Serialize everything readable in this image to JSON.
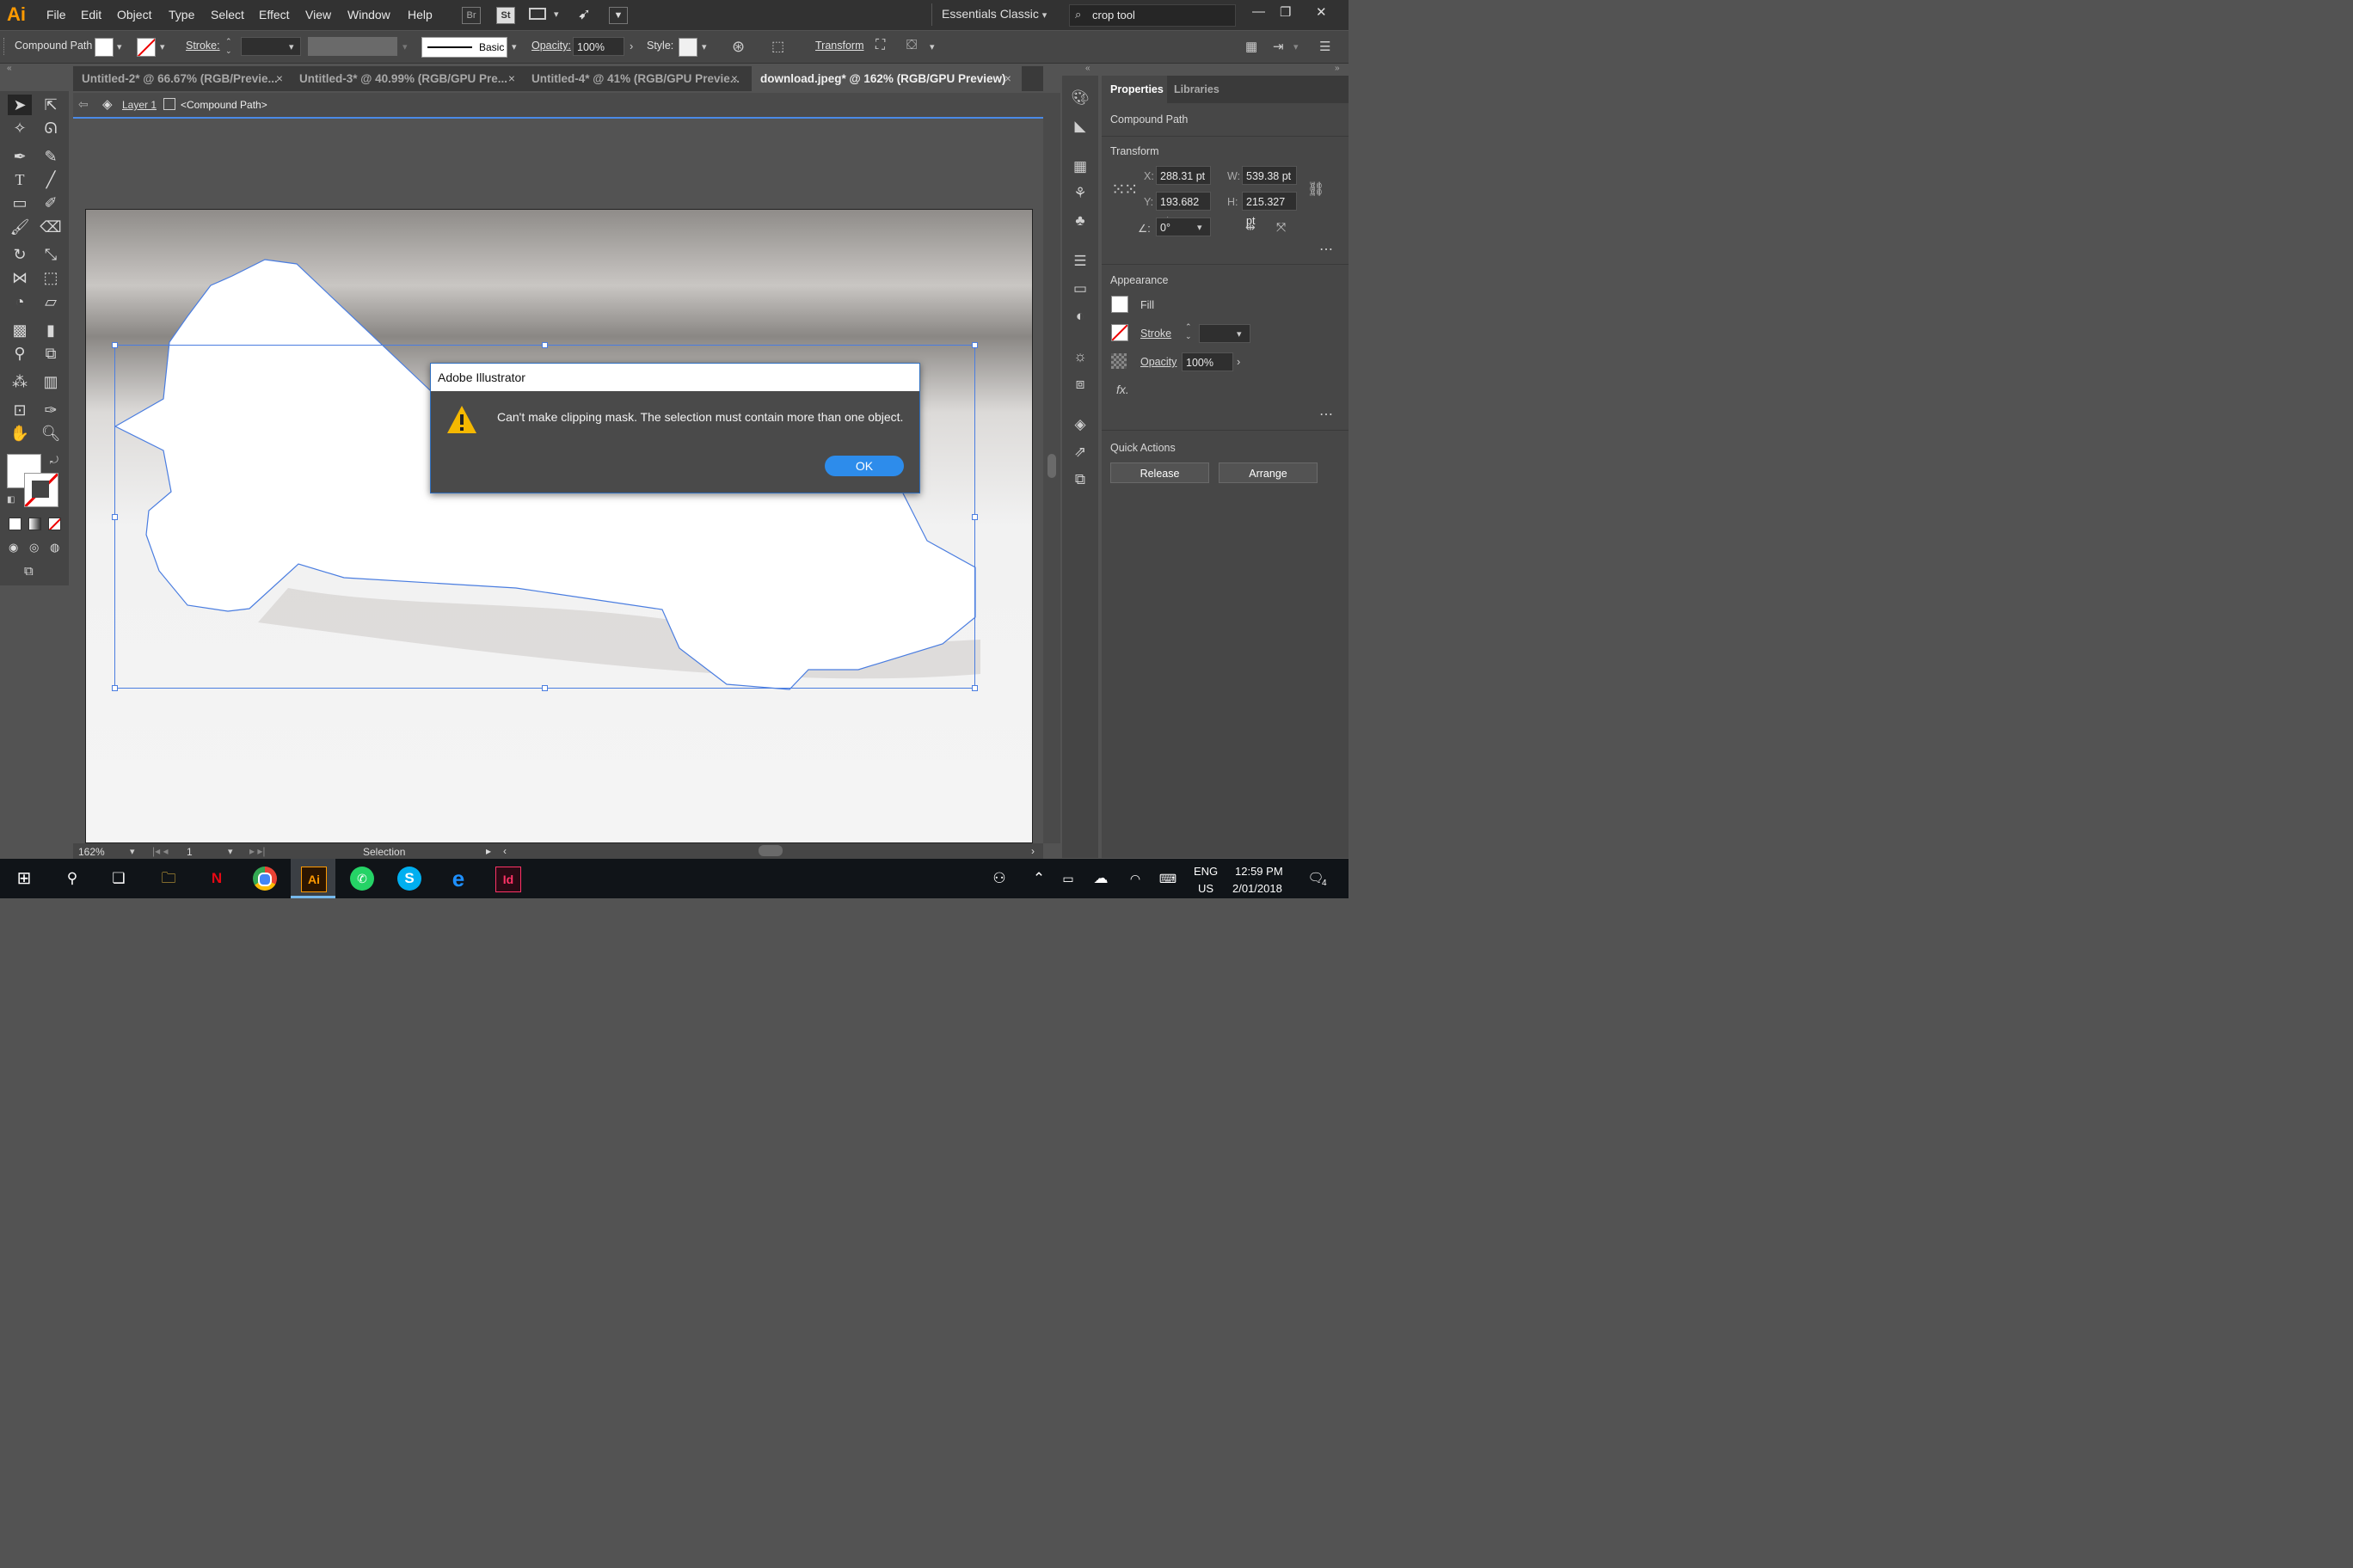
{
  "app": {
    "logo": "Ai"
  },
  "menu": [
    "File",
    "Edit",
    "Object",
    "Type",
    "Select",
    "Effect",
    "View",
    "Window",
    "Help"
  ],
  "menubar_icons": {
    "bridge": "Br",
    "stock": "St"
  },
  "workspace": "Essentials Classic",
  "search": {
    "value": "crop tool"
  },
  "controlbar": {
    "object_type": "Compound Path",
    "stroke_label": "Stroke:",
    "brush_label": "Basic",
    "opacity_label": "Opacity:",
    "opacity_value": "100%",
    "style_label": "Style:",
    "transform_label": "Transform"
  },
  "tabs": [
    {
      "label": "Untitled-2* @ 66.67% (RGB/Previe...",
      "active": false
    },
    {
      "label": "Untitled-3* @ 40.99% (RGB/GPU Pre...",
      "active": false
    },
    {
      "label": "Untitled-4* @ 41% (RGB/GPU Previe...",
      "active": false
    },
    {
      "label": "download.jpeg* @ 162% (RGB/GPU Preview)",
      "active": true
    }
  ],
  "breadcrumb": {
    "layer": "Layer 1",
    "object": "<Compound Path>"
  },
  "dialog": {
    "title": "Adobe Illustrator",
    "message": "Can't make clipping mask. The selection must contain more than one object.",
    "ok_label": "OK"
  },
  "statusbar": {
    "zoom": "162%",
    "artboard": "1",
    "tool": "Selection"
  },
  "properties": {
    "tab_properties": "Properties",
    "tab_libraries": "Libraries",
    "object_type": "Compound Path",
    "transform": {
      "heading": "Transform",
      "x_label": "X:",
      "x": "288.31 pt",
      "y_label": "Y:",
      "y": "193.682 pt",
      "w_label": "W:",
      "w": "539.38 pt",
      "h_label": "H:",
      "h": "215.327 pt",
      "angle_symbol": "∠:",
      "angle": "0°"
    },
    "appearance": {
      "heading": "Appearance",
      "fill": "Fill",
      "stroke": "Stroke",
      "opacity": "Opacity",
      "opacity_value": "100%",
      "fx": "fx."
    },
    "quick_actions": {
      "heading": "Quick Actions",
      "release": "Release",
      "arrange": "Arrange"
    }
  },
  "taskbar": {
    "lang_top": "ENG",
    "lang_bottom": "US",
    "time": "12:59 PM",
    "date": "2/01/2018",
    "notifications": "4",
    "ai_icon": "Ai",
    "id_icon": "Id",
    "skype_icon": "S",
    "edge_icon": "e",
    "netflix_icon": "N"
  },
  "colors": {
    "accent": "#2d8ceb",
    "selection": "#4a7de0",
    "ai_orange": "#ff9a00"
  }
}
